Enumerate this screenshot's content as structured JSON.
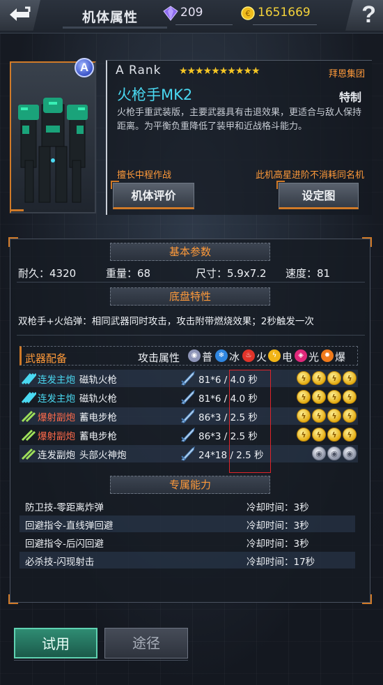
{
  "header": {
    "title": "机体属性",
    "gems": "209",
    "gold": "1651669",
    "help": "?"
  },
  "mech": {
    "rank_badge": "A",
    "rank_text": "A Rank",
    "stars": "★★★★★★★★★★",
    "faction": "拜恩集团",
    "name": "火枪手MK2",
    "type": "特制",
    "description": "火枪手重武装版，主要武器具有击退效果，更适合与敌人保持距离。为平衡负重降低了装甲和近战格斗能力。",
    "tag_left": "擅长中程作战",
    "tag_right": "此机高星进阶不消耗同名机",
    "eval_button": "机体评价",
    "setting_button": "设定图"
  },
  "basic": {
    "header": "基本参数",
    "durability": "耐久：4320",
    "weight": "重量：68",
    "size": "尺寸：5.9x7.2",
    "speed": "速度：81"
  },
  "chassis": {
    "header": "底盘特性",
    "text": "双枪手+火焰弹：相同武器同时攻击，攻击附带燃烧效果；2秒触发一次"
  },
  "weapons": {
    "title": "武器配备",
    "attr_label": "攻击属性",
    "elements": [
      {
        "name": "普",
        "color": "#8e95b8",
        "icon": "normal-icon"
      },
      {
        "name": "冰",
        "color": "#2f86e0",
        "icon": "ice-icon"
      },
      {
        "name": "火",
        "color": "#e0342a",
        "icon": "fire-icon"
      },
      {
        "name": "电",
        "color": "#f1b416",
        "icon": "lightning-icon"
      },
      {
        "name": "光",
        "color": "#e0287a",
        "icon": "light-icon"
      },
      {
        "name": "爆",
        "color": "#f07a1a",
        "icon": "explosion-icon"
      }
    ],
    "rows": [
      {
        "type": "连发主炮",
        "type_color": "#4ad9f2",
        "name": "磁轨火枪",
        "dmg": "81*6 / 4.0 秒",
        "coins": "gold"
      },
      {
        "type": "连发主炮",
        "type_color": "#4ad9f2",
        "name": "磁轨火枪",
        "dmg": "81*6 / 4.0 秒",
        "coins": "gold"
      },
      {
        "type": "爆射副炮",
        "type_color": "#ff6a4a",
        "name": "蓄电步枪",
        "dmg": "86*3 / 2.5 秒",
        "coins": "gold"
      },
      {
        "type": "爆射副炮",
        "type_color": "#ff6a4a",
        "name": "蓄电步枪",
        "dmg": "86*3 / 2.5 秒",
        "coins": "gold"
      },
      {
        "type": "连发副炮",
        "type_color": "#eef1f5",
        "name": "头部火神炮",
        "dmg": "24*18 / 2.5 秒",
        "coins": "silver"
      }
    ]
  },
  "skills": {
    "header": "专属能力",
    "rows": [
      {
        "name": "防卫技-零距离炸弹",
        "cd": "冷却时间：3秒"
      },
      {
        "name": "回避指令-直线弹回避",
        "cd": "冷却时间：3秒"
      },
      {
        "name": "回避指令-后闪回避",
        "cd": "冷却时间：3秒"
      },
      {
        "name": "必杀技-闪现射击",
        "cd": "冷却时间：17秒"
      }
    ]
  },
  "footer": {
    "trial": "试用",
    "source": "途径"
  }
}
